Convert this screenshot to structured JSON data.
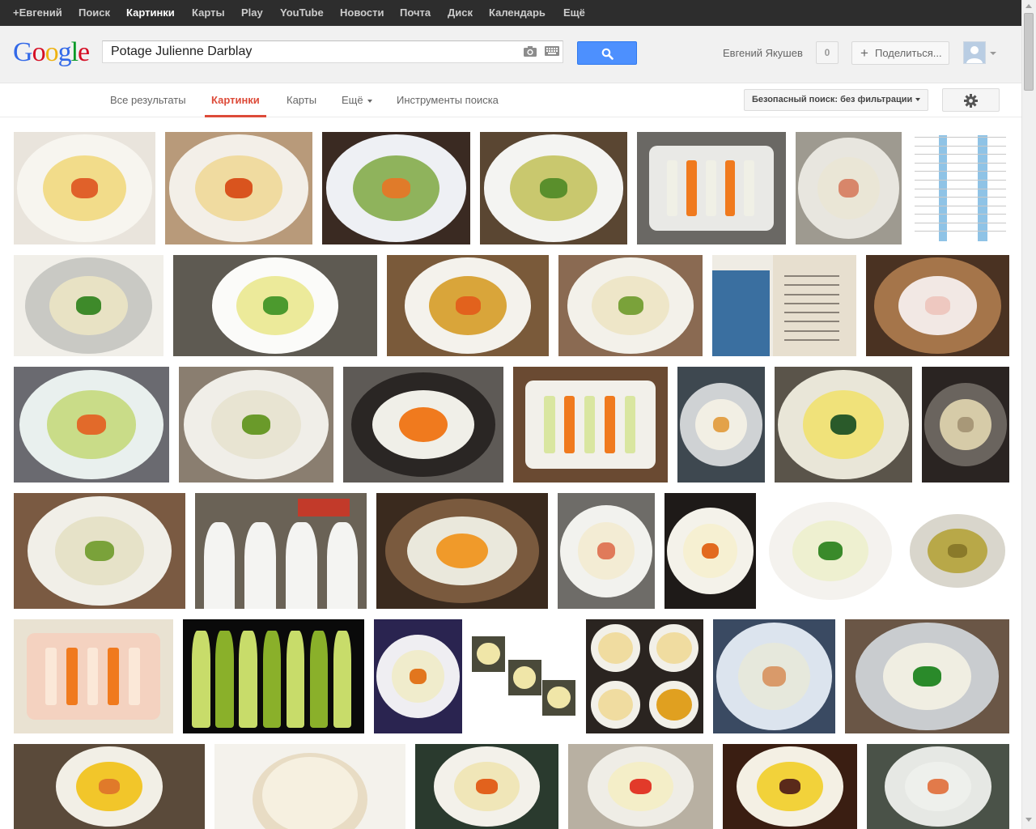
{
  "topbar": {
    "items": [
      "+Евгений",
      "Поиск",
      "Картинки",
      "Карты",
      "Play",
      "YouTube",
      "Новости",
      "Почта",
      "Диск",
      "Календарь",
      "Ещё"
    ],
    "active": "Картинки"
  },
  "logo": {
    "text": "Google"
  },
  "search": {
    "query": "Potage Julienne Darblay"
  },
  "user": {
    "name": "Евгений Якушев",
    "notifications": "0",
    "share_label": "Поделиться..."
  },
  "tabs": {
    "items": [
      "Все результаты",
      "Картинки",
      "Карты",
      "Ещё",
      "Инструменты поиска"
    ],
    "active": "Картинки"
  },
  "safe_search": {
    "label": "Безопасный поиск: без фильтрации"
  },
  "colors": {
    "topbar": "#2d2d2d",
    "accent_red": "#dd4b39",
    "search_blue": "#4d90fe"
  },
  "results": [
    {
      "kind": "soup",
      "bg": "#e9e4dc",
      "plate": "#f7f5ef",
      "soup": "#f2dc8a",
      "garnish": "#e0612a"
    },
    {
      "kind": "soup",
      "bg": "#b89a7a",
      "plate": "#f3efe8",
      "soup": "#f0dba0",
      "garnish": "#d9541e"
    },
    {
      "kind": "soup",
      "bg": "#3a2a22",
      "plate": "#eef0f4",
      "soup": "#8fb35c",
      "garnish": "#e07b2a"
    },
    {
      "kind": "soup",
      "bg": "#5a4632",
      "plate": "#f4f4f2",
      "soup": "#c9c86e",
      "garnish": "#5a8f2c"
    },
    {
      "kind": "veg",
      "bg": "#6a6864",
      "plate": "#e9e9e6",
      "soup": "#f0f0e6",
      "garnish": "#f07a1e"
    },
    {
      "kind": "soup",
      "bg": "#9e9a90",
      "plate": "#e8e6df",
      "soup": "#eae6d6",
      "garnish": "#d8866a"
    },
    {
      "kind": "doc",
      "bg": "#ffffff",
      "plate": "#8fc3e6",
      "soup": "#ffffff",
      "garnish": "#333333"
    },
    {
      "kind": "soup",
      "bg": "#f1efe9",
      "plate": "#c9c9c4",
      "soup": "#e8e2c4",
      "garnish": "#3e8a2a"
    },
    {
      "kind": "soup",
      "bg": "#5e5a52",
      "plate": "#fbfbf9",
      "soup": "#ecea9a",
      "garnish": "#4c9a2e"
    },
    {
      "kind": "soup",
      "bg": "#7a5a3a",
      "plate": "#f4f2ec",
      "soup": "#d9a53a",
      "garnish": "#e2621d"
    },
    {
      "kind": "soup",
      "bg": "#8a6a52",
      "plate": "#f3f1ea",
      "soup": "#eee6c8",
      "garnish": "#7aa23a"
    },
    {
      "kind": "doc2",
      "bg": "#efece4",
      "plate": "#3a6fa0",
      "soup": "#e7dfcf",
      "garnish": "#b4453a"
    },
    {
      "kind": "soup",
      "bg": "#4a3222",
      "plate": "#a5754a",
      "soup": "#f2e8e4",
      "garnish": "#eec8c0"
    },
    {
      "kind": "soup",
      "bg": "#6a6a70",
      "plate": "#e9f0ee",
      "soup": "#c9dc88",
      "garnish": "#e26a2a"
    },
    {
      "kind": "soup",
      "bg": "#8a7e70",
      "plate": "#f0eee8",
      "soup": "#e8e4d2",
      "garnish": "#6a9a2a"
    },
    {
      "kind": "pan",
      "bg": "#5e5a56",
      "plate": "#2a2624",
      "soup": "#f0efe8",
      "garnish": "#f07a1e"
    },
    {
      "kind": "veg",
      "bg": "#6a4a32",
      "plate": "#f2f0ea",
      "soup": "#d9e6a0",
      "garnish": "#f07a1e"
    },
    {
      "kind": "soup",
      "bg": "#3e4850",
      "plate": "#cfd2d4",
      "soup": "#f2efe4",
      "garnish": "#e3a24a"
    },
    {
      "kind": "soup",
      "bg": "#5a544a",
      "plate": "#e9e6d8",
      "soup": "#f0e27a",
      "garnish": "#2a5a2a"
    },
    {
      "kind": "soup",
      "bg": "#2a2422",
      "plate": "#6a645e",
      "soup": "#d6cba8",
      "garnish": "#a89878"
    },
    {
      "kind": "soup",
      "bg": "#7a5a42",
      "plate": "#f1efe8",
      "soup": "#e6e2c8",
      "garnish": "#7aa23a"
    },
    {
      "kind": "kitchen",
      "bg": "#6a6256",
      "plate": "#f4f4f2",
      "soup": "#3a3430",
      "garnish": "#c23a2a"
    },
    {
      "kind": "pan",
      "bg": "#3a2a1e",
      "plate": "#7a5a3e",
      "soup": "#eae8dc",
      "garnish": "#f09a2a"
    },
    {
      "kind": "soup",
      "bg": "#6e6c68",
      "plate": "#f2f2ee",
      "soup": "#f3ecd4",
      "garnish": "#e07a5a"
    },
    {
      "kind": "soup",
      "bg": "#1e1a18",
      "plate": "#f4f2ea",
      "soup": "#f6f0d2",
      "garnish": "#e26a1e"
    },
    {
      "kind": "soup",
      "bg": "#ffffff",
      "plate": "#f4f2ee",
      "soup": "#eef0d0",
      "garnish": "#3a8a2a"
    },
    {
      "kind": "soup",
      "bg": "#ffffff",
      "plate": "#d9d6cc",
      "soup": "#b8a848",
      "garnish": "#8a7a2a"
    },
    {
      "kind": "veg",
      "bg": "#e9e2d2",
      "plate": "#f4d2c0",
      "soup": "#fbe8d8",
      "garnish": "#f07a1e"
    },
    {
      "kind": "celery",
      "bg": "#0a0a0a",
      "plate": "#8ab02a",
      "soup": "#c8dc6a",
      "garnish": "#4a6a1a"
    },
    {
      "kind": "soup",
      "bg": "#2a2450",
      "plate": "#efeef2",
      "soup": "#f0eccc",
      "garnish": "#e2761e"
    },
    {
      "kind": "collage",
      "bg": "#ffffff",
      "plate": "#4a4a3a",
      "soup": "#f0e6a8",
      "garnish": "#6a8a3a"
    },
    {
      "kind": "collage4",
      "bg": "#2a2420",
      "plate": "#f2f0e8",
      "soup": "#f0dca0",
      "garnish": "#d9541e"
    },
    {
      "kind": "soup",
      "bg": "#3a4a62",
      "plate": "#dce4ee",
      "soup": "#e6e8dc",
      "garnish": "#d99a6a"
    },
    {
      "kind": "soup",
      "bg": "#6a5646",
      "plate": "#c9cccf",
      "soup": "#f0eee2",
      "garnish": "#2a8a2a"
    },
    {
      "kind": "soup",
      "bg": "#5a4a3a",
      "plate": "#f2efe6",
      "soup": "#f2c62a",
      "garnish": "#e07a2a"
    },
    {
      "kind": "cake",
      "bg": "#f4f2ec",
      "plate": "#e8dcc4",
      "soup": "#f6f0e0",
      "garnish": "#c9a46a"
    },
    {
      "kind": "soup",
      "bg": "#2a3a2e",
      "plate": "#f3f1ea",
      "soup": "#f0e6b8",
      "garnish": "#e2621d"
    },
    {
      "kind": "soup",
      "bg": "#b8b0a2",
      "plate": "#efede6",
      "soup": "#f4eec8",
      "garnish": "#e23a2a"
    },
    {
      "kind": "soup",
      "bg": "#3a1e12",
      "plate": "#f4f0e4",
      "soup": "#f2d23a",
      "garnish": "#5a2a1a"
    },
    {
      "kind": "soup",
      "bg": "#4a5248",
      "plate": "#e6e8e4",
      "soup": "#eef0ec",
      "garnish": "#e27a4a"
    }
  ]
}
